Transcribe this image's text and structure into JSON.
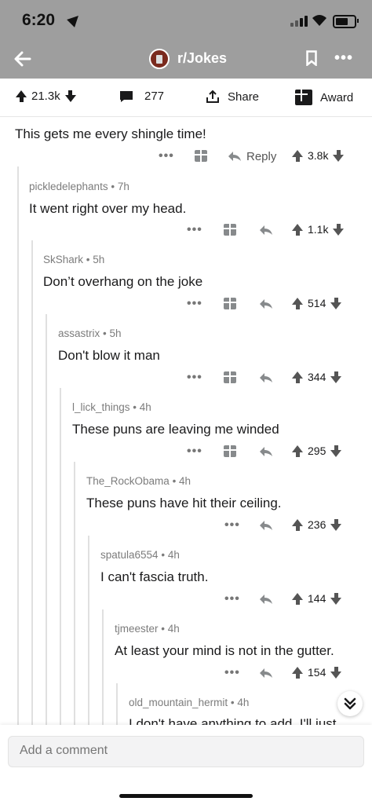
{
  "status": {
    "time": "6:20"
  },
  "header": {
    "subreddit": "r/Jokes"
  },
  "post_actions": {
    "upvotes": "21.3k",
    "comments": "277",
    "share_label": "Share",
    "award_label": "Award"
  },
  "comments": [
    {
      "author": "",
      "age": "",
      "text": "This gets me every shingle time!",
      "score": "3.8k",
      "reply_label": "Reply"
    },
    {
      "author": "pickledelephants",
      "age": "7h",
      "text": "It went right over my head.",
      "score": "1.1k"
    },
    {
      "author": "SkShark",
      "age": "5h",
      "text": "Don’t overhang on the joke",
      "score": "514"
    },
    {
      "author": "assastrix",
      "age": "5h",
      "text": "Don't blow it man",
      "score": "344"
    },
    {
      "author": "l_lick_things",
      "age": "4h",
      "text": "These puns are leaving me winded",
      "score": "295"
    },
    {
      "author": "The_RockObama",
      "age": "4h",
      "text": "These puns have hit their ceiling.",
      "score": "236"
    },
    {
      "author": "spatula6554",
      "age": "4h",
      "text": "I can't fascia truth.",
      "score": "144"
    },
    {
      "author": "tjmeester",
      "age": "4h",
      "text": "At least your mind is not in the gutter.",
      "score": "154"
    },
    {
      "author": "old_mountain_hermit",
      "age": "4h",
      "text": "I don't have anything to add. I'll just",
      "score": ""
    }
  ],
  "composer": {
    "placeholder": "Add a comment"
  }
}
